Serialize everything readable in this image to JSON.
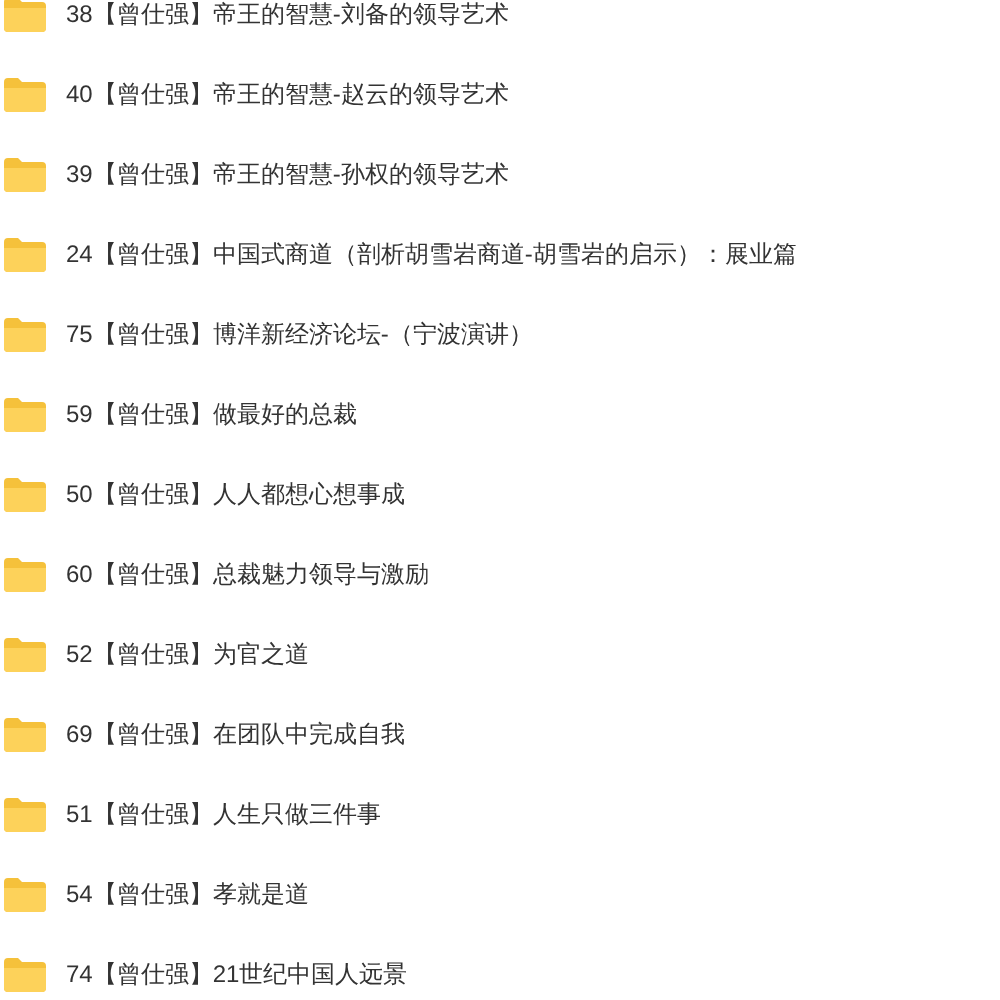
{
  "folders": [
    {
      "name": "38【曾仕强】帝王的智慧-刘备的领导艺术"
    },
    {
      "name": "40【曾仕强】帝王的智慧-赵云的领导艺术"
    },
    {
      "name": "39【曾仕强】帝王的智慧-孙权的领导艺术"
    },
    {
      "name": "24【曾仕强】中国式商道（剖析胡雪岩商道-胡雪岩的启示）：展业篇"
    },
    {
      "name": "75【曾仕强】博洋新经济论坛-（宁波演讲）"
    },
    {
      "name": "59【曾仕强】做最好的总裁"
    },
    {
      "name": "50【曾仕强】人人都想心想事成"
    },
    {
      "name": "60【曾仕强】总裁魅力领导与激励"
    },
    {
      "name": "52【曾仕强】为官之道"
    },
    {
      "name": "69【曾仕强】在团队中完成自我"
    },
    {
      "name": "51【曾仕强】人生只做三件事"
    },
    {
      "name": "54【曾仕强】孝就是道"
    },
    {
      "name": "74【曾仕强】21世纪中国人远景"
    }
  ]
}
